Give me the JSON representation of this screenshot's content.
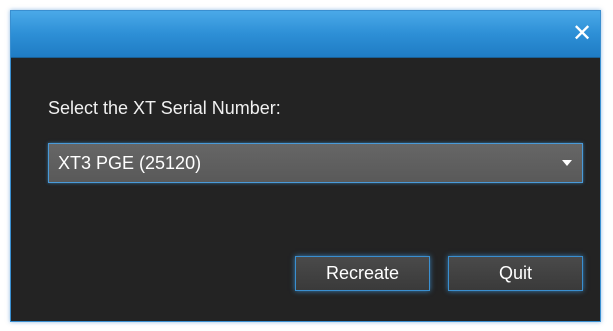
{
  "dialog": {
    "close_symbol": "✕",
    "close_icon": "close-icon"
  },
  "form": {
    "prompt": "Select the XT Serial Number:",
    "serial_select": {
      "selected_value": "XT3 PGE (25120)",
      "arrow_icon": "dropdown-arrow-icon"
    }
  },
  "buttons": {
    "recreate_label": "Recreate",
    "quit_label": "Quit"
  },
  "colors": {
    "titlebar_accent": "#2d8fd6",
    "background": "#232323",
    "border_accent": "#3a8fd0"
  }
}
